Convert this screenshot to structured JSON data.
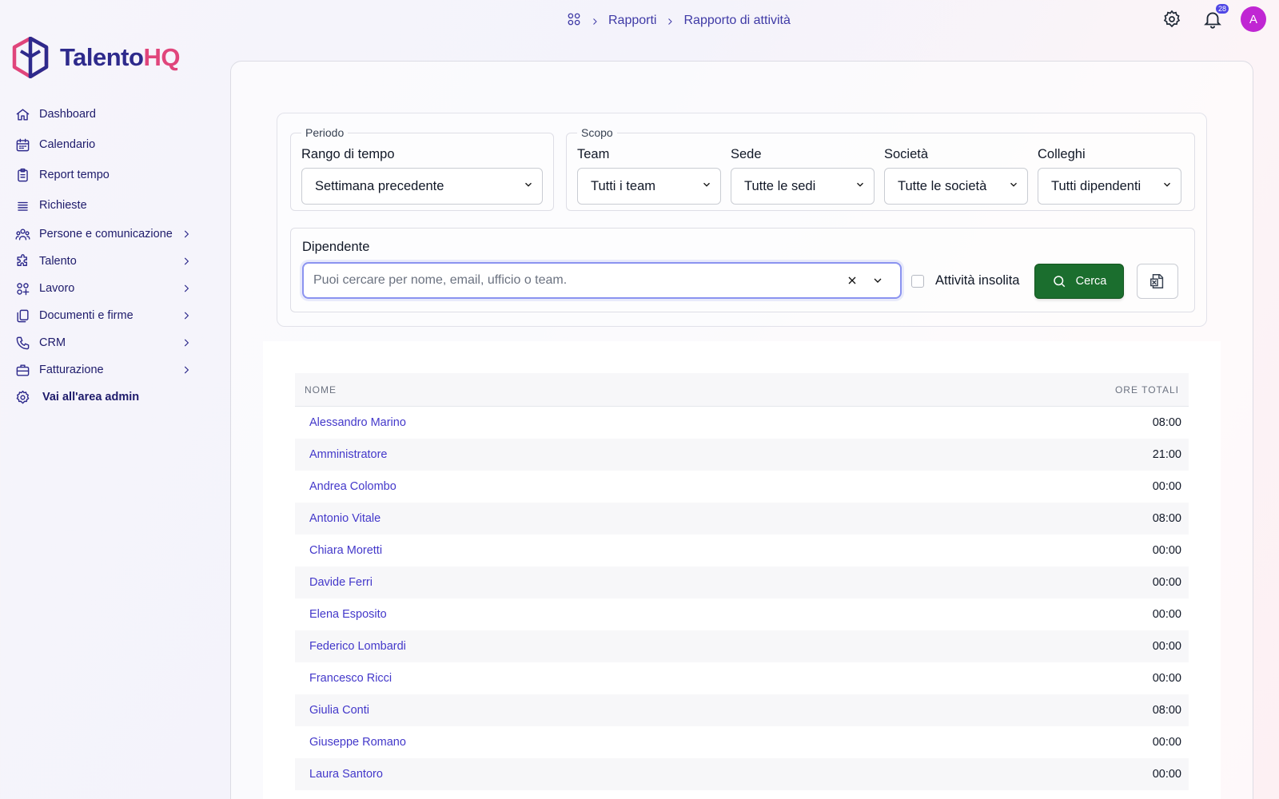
{
  "brand": {
    "name_part1": "Talento",
    "name_part2": "HQ",
    "primary": "#2e2a8c",
    "accent": "#e0457b"
  },
  "sidebar": {
    "items": [
      {
        "label": "Dashboard",
        "icon": "home-icon",
        "expandable": false
      },
      {
        "label": "Calendario",
        "icon": "calendar-icon",
        "expandable": false
      },
      {
        "label": "Report tempo",
        "icon": "clipboard-icon",
        "expandable": false
      },
      {
        "label": "Richieste",
        "icon": "list-icon",
        "expandable": false
      },
      {
        "label": "Persone e comunicazione",
        "icon": "users-icon",
        "expandable": true
      },
      {
        "label": "Talento",
        "icon": "puzzle-icon",
        "expandable": true
      },
      {
        "label": "Lavoro",
        "icon": "grid-icon",
        "expandable": true
      },
      {
        "label": "Documenti e firme",
        "icon": "documents-icon",
        "expandable": true
      },
      {
        "label": "CRM",
        "icon": "phone-icon",
        "expandable": true
      },
      {
        "label": "Fatturazione",
        "icon": "briefcase-icon",
        "expandable": true
      }
    ],
    "admin_link": {
      "label": "Vai all'area admin",
      "icon": "gear-icon"
    }
  },
  "breadcrumb": {
    "section": "Rapporti",
    "current": "Rapporto di attività"
  },
  "header": {
    "notification_count": "28",
    "avatar_initial": "A",
    "avatar_color": "#c026d3"
  },
  "filters": {
    "periodo": {
      "legend": "Periodo",
      "range_label": "Rango di tempo",
      "range_value": "Settimana precedente"
    },
    "scopo": {
      "legend": "Scopo",
      "team_label": "Team",
      "team_value": "Tutti i team",
      "sede_label": "Sede",
      "sede_value": "Tutte le sedi",
      "societa_label": "Società",
      "societa_value": "Tutte le società",
      "colleghi_label": "Colleghi",
      "colleghi_value": "Tutti dipendenti"
    },
    "dipendente": {
      "label": "Dipendente",
      "placeholder": "Puoi cercare per nome, email, ufficio o team.",
      "unusual_activity_label": "Attività insolita",
      "unusual_activity_checked": false,
      "search_button": "Cerca",
      "search_button_color": "#1b6e2e"
    }
  },
  "table": {
    "columns": [
      "NOME",
      "ORE TOTALI"
    ],
    "rows": [
      {
        "name": "Alessandro Marino",
        "hours": "08:00"
      },
      {
        "name": "Amministratore",
        "hours": "21:00"
      },
      {
        "name": "Andrea Colombo",
        "hours": "00:00"
      },
      {
        "name": "Antonio Vitale",
        "hours": "08:00"
      },
      {
        "name": "Chiara Moretti",
        "hours": "00:00"
      },
      {
        "name": "Davide Ferri",
        "hours": "00:00"
      },
      {
        "name": "Elena Esposito",
        "hours": "00:00"
      },
      {
        "name": "Federico Lombardi",
        "hours": "00:00"
      },
      {
        "name": "Francesco Ricci",
        "hours": "00:00"
      },
      {
        "name": "Giulia Conti",
        "hours": "08:00"
      },
      {
        "name": "Giuseppe Romano",
        "hours": "00:00"
      },
      {
        "name": "Laura Santoro",
        "hours": "00:00"
      }
    ]
  }
}
